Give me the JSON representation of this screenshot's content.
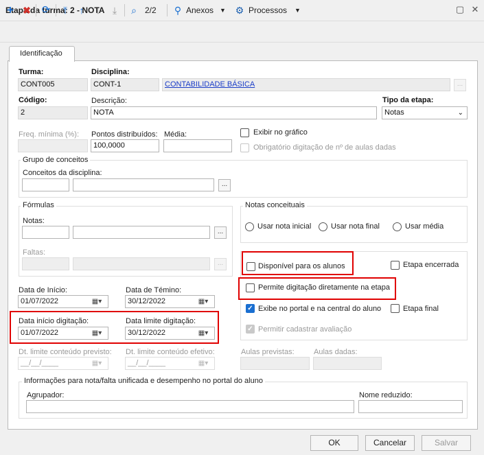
{
  "window": {
    "title": "Etapa da turma: 2 - NOTA"
  },
  "toolbar": {
    "nav_count": "2/2",
    "attachments_label": "Anexos",
    "processes_label": "Processos"
  },
  "tabs": {
    "identification": "Identificação"
  },
  "form": {
    "turma_label": "Turma:",
    "turma_value": "CONT005",
    "disciplina_label": "Disciplina:",
    "disciplina_code": "CONT-1",
    "disciplina_name": "CONTABILIDADE BÁSICA",
    "codigo_label": "Código:",
    "codigo_value": "2",
    "descricao_label": "Descrição:",
    "descricao_value": "NOTA",
    "tipo_label": "Tipo da etapa:",
    "tipo_value": "Notas",
    "freq_label": "Freq. mínima (%):",
    "pontos_label": "Pontos distribuídos:",
    "pontos_value": "100,0000",
    "media_label": "Média:",
    "exibir_grafico": "Exibir no gráfico",
    "obrigatorio_aulas": "Obrigatório digitação de nº de aulas dadas",
    "grupo_conceitos": "Grupo de conceitos",
    "conceitos_disciplina": "Conceitos da disciplina:",
    "formulas": "Fórmulas",
    "notas_label": "Notas:",
    "faltas_label": "Faltas:",
    "notas_conceituais": "Notas conceituais",
    "usar_nota_inicial": "Usar nota inicial",
    "usar_nota_final": "Usar nota final",
    "usar_media": "Usar média",
    "disponivel_alunos": "Disponível para os alunos",
    "etapa_encerrada": "Etapa encerrada",
    "permite_digitacao": "Permite digitação diretamente na etapa",
    "exibe_portal": "Exibe no portal e na central do aluno",
    "etapa_final": "Etapa final",
    "permitir_avaliacao": "Permitir cadastrar avaliação",
    "data_inicio_label": "Data de Início:",
    "data_inicio_value": "01/07/2022",
    "data_termino_label": "Data de Témino:",
    "data_termino_value": "30/12/2022",
    "data_inicio_dig_label": "Data início digitação:",
    "data_inicio_dig_value": "01/07/2022",
    "data_limite_dig_label": "Data limite digitação:",
    "data_limite_dig_value": "30/12/2022",
    "dt_limite_previsto_label": "Dt. limite conteúdo previsto:",
    "dt_limite_previsto_value": "__/__/____",
    "dt_limite_efetivo_label": "Dt. limite conteúdo efetivo:",
    "dt_limite_efetivo_value": "__/__/____",
    "aulas_previstas_label": "Aulas previstas:",
    "aulas_dadas_label": "Aulas dadas:",
    "info_portal": "Informações para nota/falta unificada e desempenho no portal do aluno",
    "agrupador_label": "Agrupador:",
    "nome_reduzido_label": "Nome reduzido:"
  },
  "footer": {
    "ok": "OK",
    "cancel": "Cancelar",
    "save": "Salvar"
  },
  "icons": {
    "add": "plus-icon",
    "delete": "x-icon",
    "refresh": "refresh-icon",
    "first": "first-icon",
    "prev": "up-arrow-icon",
    "next": "down-arrow-icon",
    "last": "last-icon",
    "search": "search-icon",
    "attach": "paperclip-icon",
    "gear": "gear-icon"
  },
  "colors": {
    "highlight": "#e00000",
    "link": "#1a3cc8",
    "check_accent": "#1a6fd1"
  }
}
